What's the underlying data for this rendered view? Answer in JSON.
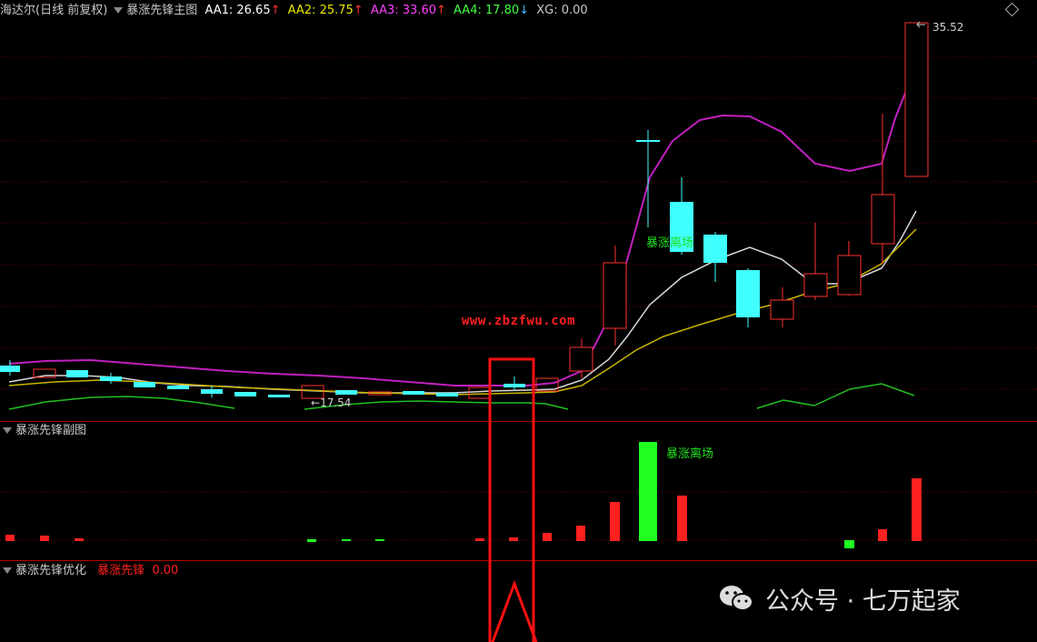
{
  "main_header": {
    "stock": "海达尔(日线 前复权)",
    "indicator": "暴涨先锋主图",
    "aa1": "AA1: 26.65",
    "aa2": "AA2: 25.75",
    "aa3": "AA3: 33.60",
    "aa4": "AA4: 17.80",
    "xg": "XG: 0.00",
    "up_arrow": "↑",
    "down_arrow": "↓"
  },
  "sub_header": {
    "title": "暴涨先锋副图"
  },
  "opt_header": {
    "title": "暴涨先锋优化",
    "label": "暴涨先锋",
    "value": "0.00"
  },
  "price_labels": {
    "high": "35.52",
    "low": "17.54",
    "low_arrow": "←"
  },
  "signal_main": "暴涨离场",
  "signal_sub": "暴涨离场",
  "watermark_url": "www.zbzfwu.com",
  "wechat_watermark": "公众号 · 七万起家",
  "colors": {
    "aa1": "#ffffff",
    "aa2": "#e8e800",
    "aa3": "#ff40ff",
    "aa4": "#40ff40",
    "up": "#ff3030",
    "down": "#40c0ff",
    "accent_red": "#ff0000"
  }
}
